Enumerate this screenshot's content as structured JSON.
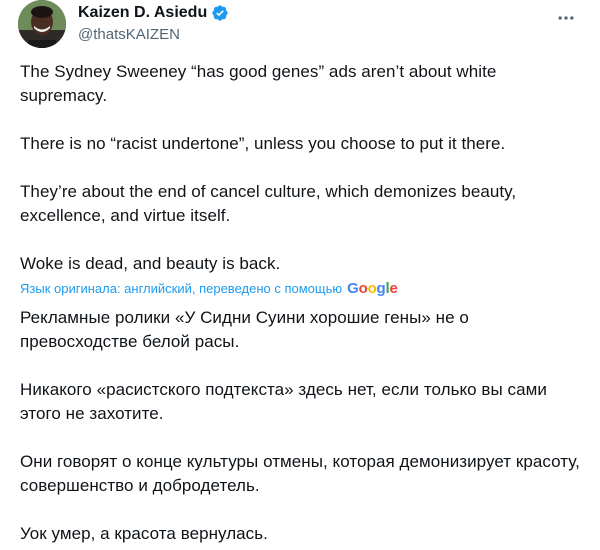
{
  "author": {
    "display_name": "Kaizen D. Asiedu",
    "handle": "@thatsKAIZEN",
    "verified_icon": "verified-badge-icon",
    "avatar_icon": "avatar"
  },
  "menu": {
    "icon": "more-horizontal-icon"
  },
  "original": {
    "paragraphs": [
      "The Sydney Sweeney “has good genes” ads aren’t about white supremacy.",
      "There is no “racist undertone”, unless you choose to put it there.",
      "They’re about the end of cancel culture, which demonizes beauty, excellence, and virtue itself.",
      "Woke is dead, and beauty is back."
    ]
  },
  "translation": {
    "note": "Язык оригинала: английский, переведено с помощью",
    "provider_letters": [
      "G",
      "o",
      "o",
      "g",
      "l",
      "e"
    ],
    "paragraphs": [
      "Рекламные ролики «У Сидни Суини хорошие гены» не о превосходстве белой расы.",
      "Никакого «расистского подтекста» здесь нет, если только вы сами этого не захотите.",
      "Они говорят о конце культуры отмены, которая демонизирует красоту, совершенство и добродетель.",
      "Уок умер, а красота вернулась."
    ]
  },
  "colors": {
    "text": "#0f1419",
    "secondary": "#536471",
    "link": "#1d9bf0",
    "verified": "#1d9bf0"
  }
}
